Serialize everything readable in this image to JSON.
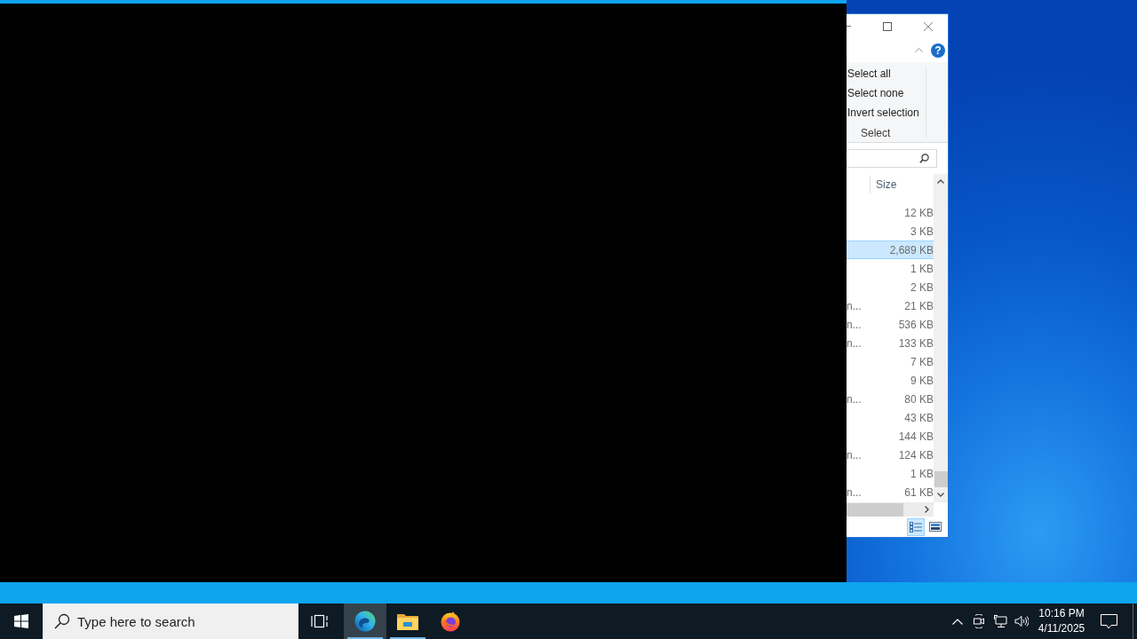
{
  "explorer_window": {
    "help": "?",
    "ribbon_group": {
      "commands": [
        "Select all",
        "Select none",
        "Invert selection"
      ],
      "label": "Select"
    },
    "columns": [
      {
        "label": "Size"
      }
    ],
    "rows": [
      {
        "size": "12 KB",
        "selected": false
      },
      {
        "size": "3 KB",
        "selected": false
      },
      {
        "size": "2,689 KB",
        "selected": true
      },
      {
        "size": "1 KB",
        "selected": false
      },
      {
        "size": "2 KB",
        "selected": false
      },
      {
        "column_1": "n...",
        "size": "21 KB",
        "selected": false
      },
      {
        "column_1": "n...",
        "size": "536 KB",
        "selected": false
      },
      {
        "column_1": "n...",
        "size": "133 KB",
        "selected": false
      },
      {
        "size": "7 KB",
        "selected": false
      },
      {
        "size": "9 KB",
        "selected": false
      },
      {
        "column_1": "n...",
        "size": "80 KB",
        "selected": false
      },
      {
        "size": "43 KB",
        "selected": false
      },
      {
        "size": "144 KB",
        "selected": false
      },
      {
        "column_1": "n...",
        "size": "124 KB",
        "selected": false
      },
      {
        "size": "1 KB",
        "selected": false
      },
      {
        "column_1": "n...",
        "size": "61 KB",
        "selected": false
      }
    ],
    "views": [
      {
        "kind": "details",
        "selected": true
      },
      {
        "kind": "large_icons",
        "selected": false
      }
    ]
  },
  "taskbar": {
    "search": {
      "placeholder": "Type here to search"
    },
    "apps": [
      {
        "kind": "edge",
        "selected": true,
        "running": true
      },
      {
        "kind": "file_explorer",
        "selected": false,
        "running": true
      },
      {
        "kind": "firefox",
        "selected": false,
        "running": false
      }
    ],
    "clock": {
      "time": "10:16 PM",
      "date": "4/11/2025"
    }
  }
}
